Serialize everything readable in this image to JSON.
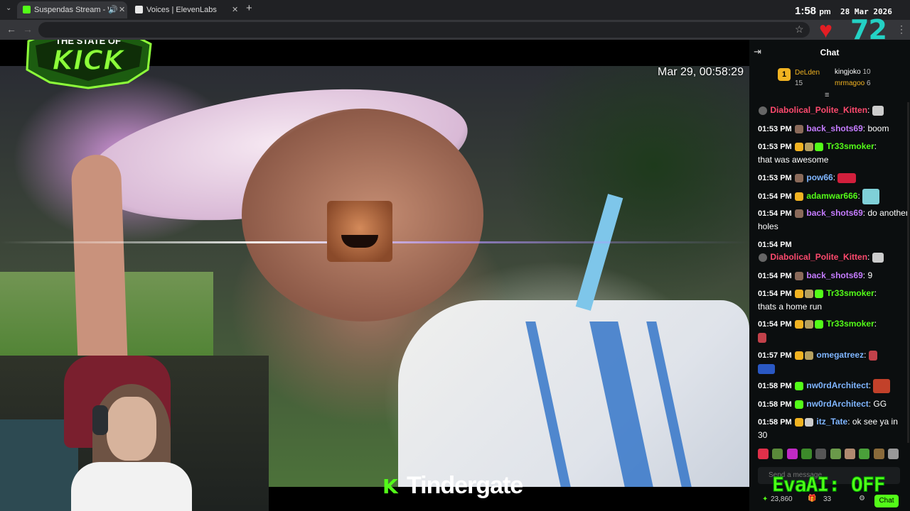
{
  "browser": {
    "tabs": [
      {
        "title": "Suspendas Stream - Watch",
        "active": true,
        "favicon_color": "#53fc18"
      },
      {
        "title": "Voices | ElevenLabs",
        "active": false,
        "favicon_color": "#e8e8e8"
      }
    ],
    "new_tab": "+",
    "clock": {
      "time": "1:58",
      "ampm": "pm",
      "date": "28 Mar 2026"
    }
  },
  "overlay": {
    "heart": "♥",
    "viewer_count": "72",
    "logo_line1": "THE STATE OF",
    "logo_line2": "KICK",
    "vod_timestamp": "Mar 29, 00:58:29",
    "kick_k": "K",
    "caption": "Tindergate",
    "evaai": "EvaAI: OFF"
  },
  "chat": {
    "title": "Chat",
    "gifters": {
      "rank": "1",
      "first_name": "DeLden",
      "first_count": "15",
      "second_name": "kingjoko",
      "second_count": "10",
      "third_name": "mrmagoo",
      "third_count": "6"
    },
    "messages": [
      {
        "time": "",
        "user": "Diabolical_Polite_Kitten",
        "color": "#ff4a6e",
        "text": ""
      },
      {
        "time": "01:53 PM",
        "user": "back_shots69",
        "color": "#c57cff",
        "text": "boom"
      },
      {
        "time": "01:53 PM",
        "user": "Tr33smoker",
        "color": "#53fc18",
        "text": "that was awesome"
      },
      {
        "time": "01:53 PM",
        "user": "pow66",
        "color": "#7fb5ff",
        "text": ""
      },
      {
        "time": "01:54 PM",
        "user": "adamwar666",
        "color": "#53fc18",
        "text": ""
      },
      {
        "time": "01:54 PM",
        "user": "back_shots69",
        "color": "#c57cff",
        "text": "do another holes"
      },
      {
        "time": "01:54 PM",
        "user": "",
        "color": "#ffffff",
        "text": ""
      },
      {
        "time": "",
        "user": "Diabolical_Polite_Kitten",
        "color": "#ff4a6e",
        "text": ""
      },
      {
        "time": "01:54 PM",
        "user": "back_shots69",
        "color": "#c57cff",
        "text": "9"
      },
      {
        "time": "01:54 PM",
        "user": "Tr33smoker",
        "color": "#53fc18",
        "text": "thats a home run"
      },
      {
        "time": "01:54 PM",
        "user": "Tr33smoker",
        "color": "#53fc18",
        "text": ""
      },
      {
        "time": "01:57 PM",
        "user": "omegatreez",
        "color": "#7fb5ff",
        "text": ""
      },
      {
        "time": "01:58 PM",
        "user": "nw0rdArchitect",
        "color": "#7fb5ff",
        "text": ""
      },
      {
        "time": "01:58 PM",
        "user": "nw0rdArchitect",
        "color": "#7fb5ff",
        "text": "GG"
      },
      {
        "time": "01:58 PM",
        "user": "itz_Tate",
        "color": "#7fb5ff",
        "text": "ok see ya in 30"
      }
    ],
    "input_placeholder": "Send a message",
    "footer": {
      "points": "23,860",
      "gift_count": "33",
      "send_label": "Chat"
    }
  }
}
